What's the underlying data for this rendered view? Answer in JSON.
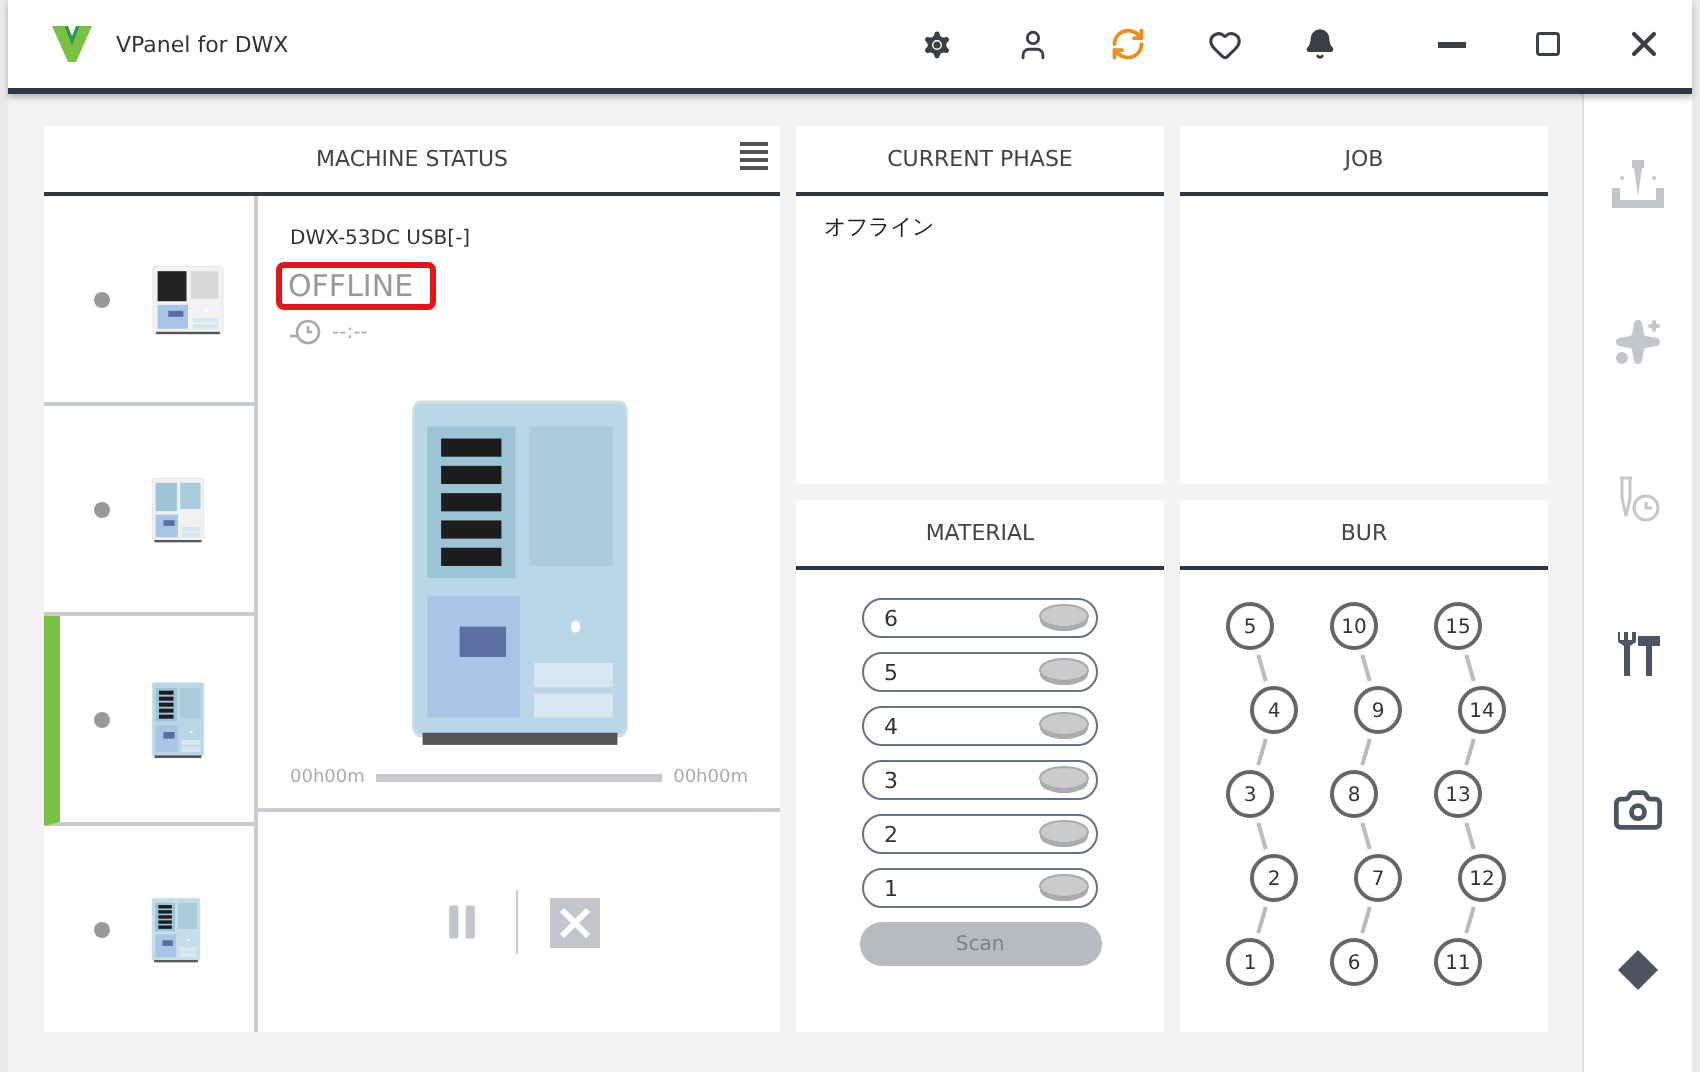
{
  "window": {
    "title": "VPanel for DWX"
  },
  "machine_status": {
    "title": "MACHINE STATUS",
    "machines": [
      {
        "selected": false
      },
      {
        "selected": false
      },
      {
        "selected": true
      },
      {
        "selected": false
      }
    ],
    "detail": {
      "model": "DWX-53DC USB[-]",
      "status": "OFFLINE",
      "status_highlighted": true,
      "remaining": "--:--",
      "elapsed": "00h00m",
      "total": "00h00m",
      "level": 0
    },
    "controls": {
      "pause_disabled": true,
      "stop_disabled": true
    }
  },
  "current_phase": {
    "title": "CURRENT PHASE",
    "text": "オフライン"
  },
  "job": {
    "title": "JOB"
  },
  "material": {
    "title": "MATERIAL",
    "slots": [
      {
        "label": "6"
      },
      {
        "label": "5"
      },
      {
        "label": "4"
      },
      {
        "label": "3"
      },
      {
        "label": "2"
      },
      {
        "label": "1"
      }
    ],
    "scan_button": {
      "label": "Scan",
      "disabled": true
    }
  },
  "bur": {
    "title": "BUR",
    "slots": [
      "1",
      "2",
      "3",
      "4",
      "5",
      "6",
      "7",
      "8",
      "9",
      "10",
      "11",
      "12",
      "13",
      "14",
      "15"
    ]
  },
  "side_tools": [
    {
      "kind": "milling",
      "disabled": true
    },
    {
      "kind": "sparkles",
      "disabled": true
    },
    {
      "kind": "schedule",
      "disabled": true
    },
    {
      "kind": "tools",
      "disabled": false
    },
    {
      "kind": "camera",
      "disabled": false
    },
    {
      "kind": "diamond",
      "disabled": false
    }
  ]
}
